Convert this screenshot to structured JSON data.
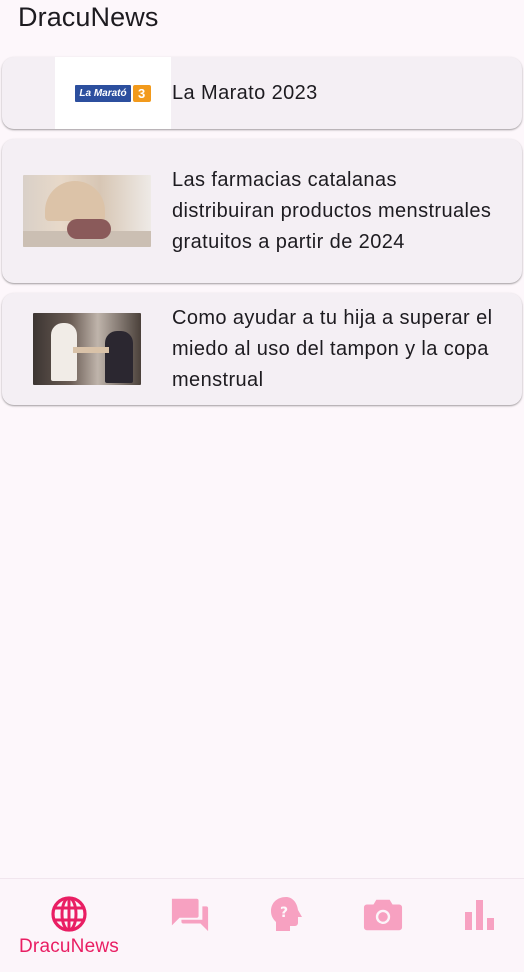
{
  "app": {
    "title": "DracuNews"
  },
  "news": [
    {
      "title": "La Marato 2023",
      "thumbnail": {
        "logo_text": "La Marató",
        "logo_badge": "3"
      }
    },
    {
      "title": "Las farmacias catalanas distribuiran productos menstruales gratuitos a partir de 2024"
    },
    {
      "title": "Como ayudar a tu hija a superar el miedo al uso del tampon y la copa menstrual"
    }
  ],
  "bottom_nav": {
    "items": [
      {
        "icon": "globe-icon",
        "label": "DracuNews",
        "active": true
      },
      {
        "icon": "forum-icon",
        "label": "",
        "active": false
      },
      {
        "icon": "question-head-icon",
        "label": "",
        "active": false
      },
      {
        "icon": "camera-icon",
        "label": "",
        "active": false
      },
      {
        "icon": "bar-chart-icon",
        "label": "",
        "active": false
      }
    ],
    "active_color": "#e91e63",
    "inactive_color": "#f7a1c1"
  }
}
